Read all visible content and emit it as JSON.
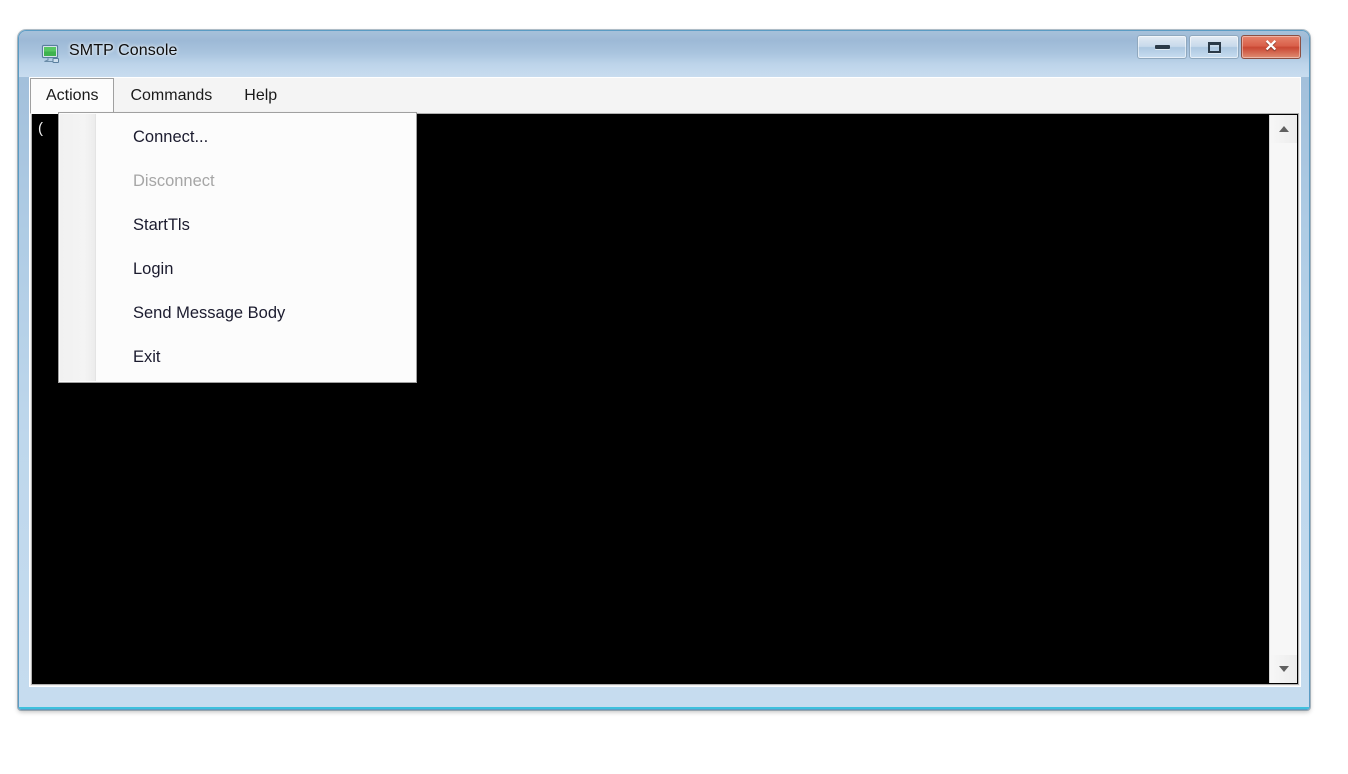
{
  "window": {
    "title": "SMTP Console",
    "icon": "computer-monitor-icon",
    "caption_buttons": {
      "minimize_label": "–",
      "maximize_label": "□",
      "close_label": "✕"
    }
  },
  "menubar": {
    "items": [
      {
        "label": "Actions",
        "open": true
      },
      {
        "label": "Commands",
        "open": false
      },
      {
        "label": "Help",
        "open": false
      }
    ]
  },
  "dropdown": {
    "owner": "Actions",
    "items": [
      {
        "label": "Connect...",
        "disabled": false
      },
      {
        "label": "Disconnect",
        "disabled": true
      },
      {
        "label": "StartTls",
        "disabled": false
      },
      {
        "label": "Login",
        "disabled": false
      },
      {
        "label": "Send Message Body",
        "disabled": false
      },
      {
        "label": "Exit",
        "disabled": false
      }
    ]
  },
  "console": {
    "text": "(",
    "background": "#000000",
    "foreground": "#f2f2f2"
  },
  "scrollbar": {
    "up_arrow": "scroll-up-arrow",
    "down_arrow": "scroll-down-arrow"
  },
  "colors": {
    "title_gradient_top": "#a7c1da",
    "title_gradient_bottom": "#c8dcef",
    "frame_border": "#5b9cc4",
    "frame_accent": "#3ec0dd",
    "close_button": "#c94733",
    "menu_background": "#f4f4f4",
    "dropdown_background": "#fcfcfc",
    "disabled_text": "#a6a6a6"
  }
}
